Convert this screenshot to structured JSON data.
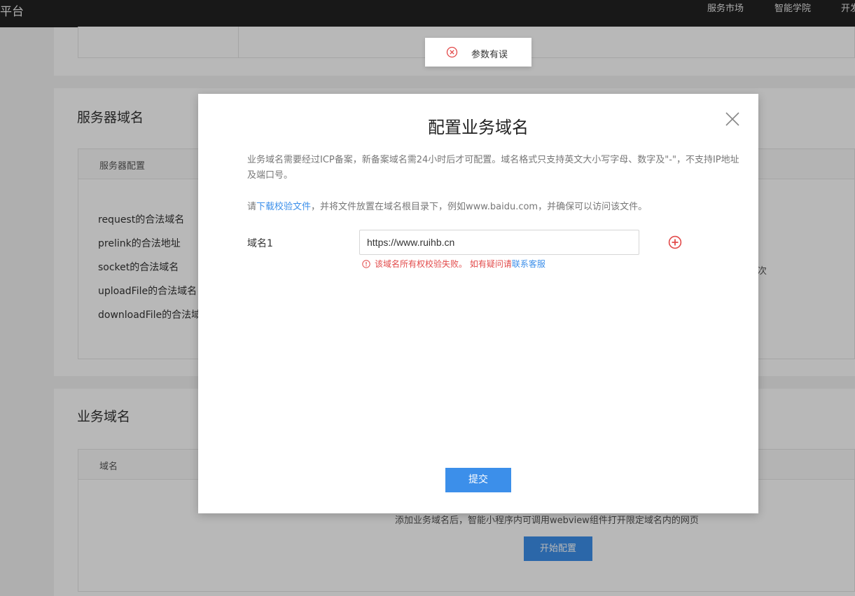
{
  "header": {
    "brand": "平台",
    "nav": [
      "服务市场",
      "智能学院",
      "开发"
    ]
  },
  "server_section": {
    "title": "服务器域名",
    "table_header": "服务器配置",
    "rows": [
      "request的合法域名",
      "prelink的合法地址",
      "socket的合法域名",
      "uploadFile的合法域名",
      "downloadFile的合法域名"
    ],
    "right_fragment": "次"
  },
  "business_section": {
    "title": "业务域名",
    "table_header": "域名",
    "empty_text": "添加业务域名后，智能小程序内可调用webview组件打开限定域名内的网页",
    "start_button": "开始配置"
  },
  "toast": {
    "message": "参数有误",
    "icon": "error-circle-icon"
  },
  "modal": {
    "title": "配置业务域名",
    "description": "业务域名需要经过ICP备案，新备案域名需24小时后才可配置。域名格式只支持英文大小写字母、数字及\"-\"，不支持IP地址及端口号。",
    "hint_prefix": "请",
    "hint_link": "下载校验文件",
    "hint_suffix": "，并将文件放置在域名根目录下，例如www.baidu.com，并确保可以访问该文件。",
    "field_label": "域名1",
    "field_value": "https://www.ruihb.cn",
    "error_text": "该域名所有权校验失败。 如有疑问请",
    "error_link": "联系客服",
    "submit_label": "提交"
  },
  "colors": {
    "accent": "#3c8fea",
    "error": "#e24a4a",
    "topbar": "#222222"
  }
}
